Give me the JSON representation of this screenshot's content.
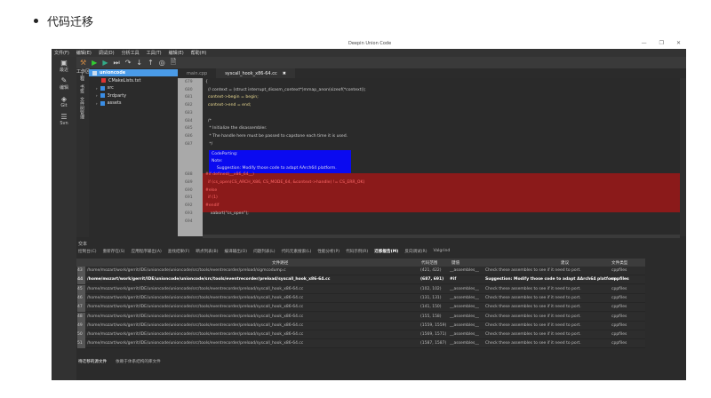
{
  "heading": "代码迁移",
  "window": {
    "title": "Deepin Union Code",
    "controls": [
      "—",
      "❐",
      "✕"
    ]
  },
  "menu": [
    "文件(F)",
    "编辑(E)",
    "调试(D)",
    "分析工具",
    "工具(T)",
    "编辑(E)",
    "帮助(H)"
  ],
  "activity": [
    {
      "icon": "▣",
      "label": "最近"
    },
    {
      "icon": "✎",
      "label": "编辑"
    },
    {
      "icon": "◈",
      "label": "Git"
    },
    {
      "icon": "☰",
      "label": "Svn"
    }
  ],
  "sidebar": {
    "header": "工作区",
    "tabs": [
      "工程",
      "书签",
      "文件树管理"
    ],
    "tree": [
      {
        "label": "unioncode",
        "type": "root"
      },
      {
        "label": "CMakeLists.txt",
        "type": "cmake"
      },
      {
        "label": "src",
        "type": "folder"
      },
      {
        "label": "3rdparty",
        "type": "folder"
      },
      {
        "label": "assets",
        "type": "folder"
      }
    ]
  },
  "editor": {
    "tabs": [
      {
        "label": "main.cpp",
        "active": false
      },
      {
        "label": "syscall_hook_x86-64.cc",
        "active": true
      }
    ],
    "lines": [
      {
        "n": "679",
        "text": "{"
      },
      {
        "n": "680",
        "text": "  // context = (struct interrupt_disasm_context*)mmap_anon(sizeof(*context));"
      },
      {
        "n": "681",
        "text": "  context->begin = begin;"
      },
      {
        "n": "682",
        "text": "  context->end = end;"
      },
      {
        "n": "683",
        "text": ""
      },
      {
        "n": "684",
        "text": "  /*"
      },
      {
        "n": "685",
        "text": "   * Initialize the disassembler."
      },
      {
        "n": "686",
        "text": "   * The handle here must be passed to capstone each time it is used."
      },
      {
        "n": "687",
        "text": "   */"
      },
      {
        "n": "688",
        "text": "#if defined(__x86_64__)"
      },
      {
        "n": "689",
        "text": "  if (cs_open(CS_ARCH_X86, CS_MODE_64, &context->handle) != CS_ERR_OK)"
      },
      {
        "n": "690",
        "text": "#else"
      },
      {
        "n": "691",
        "text": "  if (1)"
      },
      {
        "n": "692",
        "text": "#endif"
      },
      {
        "n": "693",
        "text": "    xabort(\"cs_open\");"
      },
      {
        "n": "694",
        "text": ""
      }
    ],
    "annotation": [
      "CodePorting:",
      "Note:",
      "    Suggestion: Modify those code to adapt AArch64 platform."
    ],
    "colors": {
      "highlight_blue": "#0a0af0",
      "highlight_red": "#8b1a1a"
    }
  },
  "panel": {
    "label": "交本",
    "tabs": [
      "控制台(C)",
      "重新存在(S)",
      "应用程序输出(A)",
      "查找结果(F)",
      "断点列表(B)",
      "编译输出(O)",
      "问题列表(L)",
      "代码元素搜索(L)",
      "性能分析(P)",
      "代码示例(R)",
      "迁移报告(M)",
      "反向调试(R)",
      "Valgrind"
    ],
    "active_tab": "迁移报告(M)",
    "columns": [
      "文件路径",
      "代码范围",
      "键值",
      "建议",
      "文件类型"
    ],
    "rows": [
      {
        "n": "43",
        "path": "/home/mozart/work/gerrit/IDE/unioncode/unioncode/src/tools/eventrecorder/preload/sigmcodump.c",
        "range": "(421, 422)",
        "key": "__assembles__",
        "suggest": "Check these assembles to see if it need to port.",
        "type": "cppfiles",
        "bold": false
      },
      {
        "n": "44",
        "path": "/home/mozart/work/gerrit/IDE/unioncode/unioncode/src/tools/eventrecorder/preload/syscall_hook_x86-64.cc",
        "range": "(687, 691)",
        "key": "#if",
        "suggest": "Suggestion: Modify those code to adapt AArch64 platform.",
        "type": "cppfiles",
        "bold": true
      },
      {
        "n": "45",
        "path": "/home/mozart/work/gerrit/IDE/unioncode/unioncode/src/tools/eventrecorder/preload/syscall_hook_x86-64.cc",
        "range": "(102, 102)",
        "key": "__assembles__",
        "suggest": "Check these assembles to see if it need to port.",
        "type": "cppfiles",
        "bold": false
      },
      {
        "n": "46",
        "path": "/home/mozart/work/gerrit/IDE/unioncode/unioncode/src/tools/eventrecorder/preload/syscall_hook_x86-64.cc",
        "range": "(131, 131)",
        "key": "__assembles__",
        "suggest": "Check these assembles to see if it need to port.",
        "type": "cppfiles",
        "bold": false
      },
      {
        "n": "47",
        "path": "/home/mozart/work/gerrit/IDE/unioncode/unioncode/src/tools/eventrecorder/preload/syscall_hook_x86-64.cc",
        "range": "(141, 150)",
        "key": "__assembles__",
        "suggest": "Check these assembles to see if it need to port.",
        "type": "cppfiles",
        "bold": false
      },
      {
        "n": "48",
        "path": "/home/mozart/work/gerrit/IDE/unioncode/unioncode/src/tools/eventrecorder/preload/syscall_hook_x86-64.cc",
        "range": "(155, 158)",
        "key": "__assembles__",
        "suggest": "Check these assembles to see if it need to port.",
        "type": "cppfiles",
        "bold": false
      },
      {
        "n": "49",
        "path": "/home/mozart/work/gerrit/IDE/unioncode/unioncode/src/tools/eventrecorder/preload/syscall_hook_x86-64.cc",
        "range": "(1559, 1559)",
        "key": "__assembles__",
        "suggest": "Check these assembles to see if it need to port.",
        "type": "cppfiles",
        "bold": false
      },
      {
        "n": "50",
        "path": "/home/mozart/work/gerrit/IDE/unioncode/unioncode/src/tools/eventrecorder/preload/syscall_hook_x86-64.cc",
        "range": "(1569, 1571)",
        "key": "__assembles__",
        "suggest": "Check these assembles to see if it need to port.",
        "type": "cppfiles",
        "bold": false
      },
      {
        "n": "51",
        "path": "/home/mozart/work/gerrit/IDE/unioncode/unioncode/src/tools/eventrecorder/preload/syscall_hook_x86-64.cc",
        "range": "(1587, 1587)",
        "key": "__assembles__",
        "suggest": "Check these assembles to see if it need to port.",
        "type": "cppfiles",
        "bold": false
      }
    ],
    "bottom_tabs": [
      "待迁移的源文件",
      "依赖于体系结构的库文件"
    ]
  }
}
